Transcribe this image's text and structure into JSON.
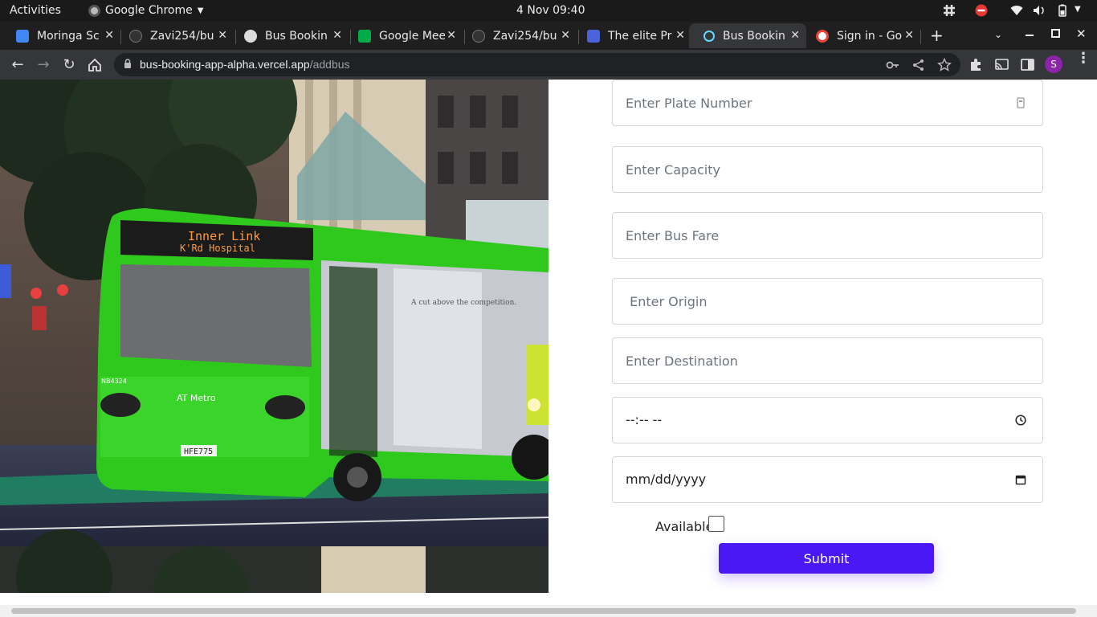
{
  "topbar": {
    "activities": "Activities",
    "app_name": "Google Chrome",
    "clock": "4 Nov  09:40"
  },
  "tabs": [
    {
      "title": "Moringa Sc",
      "favicon_color": "#4285f4",
      "active": false
    },
    {
      "title": "Zavi254/bu",
      "favicon_color": "#333333",
      "active": false
    },
    {
      "title": "Bus Bookin",
      "favicon_color": "#dddddd",
      "active": false
    },
    {
      "title": "Google Mee",
      "favicon_color": "#00ac47",
      "active": false
    },
    {
      "title": "Zavi254/bu",
      "favicon_color": "#333333",
      "active": false
    },
    {
      "title": "The elite Pr",
      "favicon_color": "#4b63d8",
      "active": false
    },
    {
      "title": "Bus Bookin",
      "favicon_color": "#61dafb",
      "active": true
    },
    {
      "title": "Sign in - Go",
      "favicon_color": "#ea4335",
      "active": false
    }
  ],
  "address_bar": {
    "host": "bus-booking-app-alpha.vercel.app",
    "path": "/addbus"
  },
  "profile_initial": "S",
  "form": {
    "plate_placeholder": "Enter Plate Number",
    "capacity_placeholder": "Enter Capacity",
    "fare_placeholder": "Enter Bus Fare",
    "origin_placeholder": " Enter Origin",
    "destination_placeholder": "Enter Destination",
    "time_value": "--:-- --",
    "date_value": "mm/dd/yyyy",
    "available_label": "Available",
    "available_checked": false,
    "submit_label": "Submit"
  },
  "hero_image": {
    "bus_sign_line1": "Inner Link",
    "bus_sign_line2": "K'Rd    Hospital",
    "brand": "AT Metro",
    "plate": "HFE775",
    "fleet_no": "NB4324",
    "side_ad": "A cut above the competition.",
    "bus_color": "#2fc91e"
  }
}
